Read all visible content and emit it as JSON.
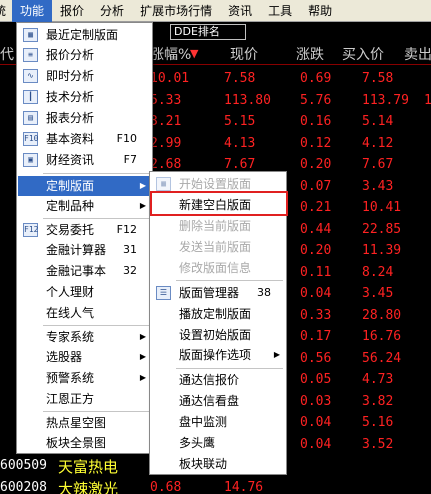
{
  "menubar": {
    "items": [
      "统",
      "功能",
      "报价",
      "分析",
      "扩展市场行情",
      "资讯",
      "工具",
      "帮助"
    ],
    "active_index": 1
  },
  "grid": {
    "dde_label": "DDE排名",
    "headers": {
      "code_prefix": "代",
      "change_pct": "涨幅%",
      "sort_arrow": "▼",
      "price": "现价",
      "change": "涨跌",
      "bid": "买入价",
      "ask": "卖出"
    },
    "rows": [
      {
        "pct": "10.01",
        "price": "7.58",
        "chg": "0.69",
        "bid": "7.58"
      },
      {
        "pct": "5.33",
        "price": "113.80",
        "chg": "5.76",
        "bid": "113.79",
        "ask": "1"
      },
      {
        "pct": "3.21",
        "price": "5.15",
        "chg": "0.16",
        "bid": "5.14"
      },
      {
        "pct": "2.99",
        "price": "4.13",
        "chg": "0.12",
        "bid": "4.12"
      },
      {
        "pct": "2.68",
        "price": "7.67",
        "chg": "0.20",
        "bid": "7.67"
      },
      {
        "chg": "0.07",
        "bid": "3.43"
      },
      {
        "chg": "0.21",
        "bid": "10.41"
      },
      {
        "chg": "0.44",
        "bid": "22.85"
      },
      {
        "chg": "0.20",
        "bid": "11.39"
      },
      {
        "chg": "0.11",
        "bid": "8.24"
      },
      {
        "chg": "0.04",
        "bid": "3.45"
      },
      {
        "chg": "0.33",
        "bid": "28.80"
      },
      {
        "chg": "0.17",
        "bid": "16.76"
      },
      {
        "chg": "0.56",
        "bid": "56.24"
      },
      {
        "chg": "0.05",
        "bid": "4.73"
      },
      {
        "chg": "0.03",
        "bid": "3.82"
      },
      {
        "chg": "0.04",
        "bid": "5.16"
      },
      {
        "chg": "0.04",
        "bid": "3.52"
      },
      {
        "code": "600509",
        "name": "天富热电"
      },
      {
        "code": "600208",
        "name": "大辣激光",
        "pct": "0.68",
        "price": "14.76"
      }
    ]
  },
  "menu_function": {
    "items": [
      {
        "label": "最近定制版面",
        "icon": "recent-layout-icon"
      },
      {
        "label": "报价分析",
        "icon": "quote-analysis-icon"
      },
      {
        "label": "即时分析",
        "icon": "realtime-analysis-icon"
      },
      {
        "label": "技术分析",
        "icon": "technical-analysis-icon"
      },
      {
        "label": "报表分析",
        "icon": "report-analysis-icon"
      },
      {
        "label": "基本资料",
        "accel": "F10",
        "icon": "f10-icon"
      },
      {
        "label": "财经资讯",
        "accel": "F7",
        "icon": "news-icon"
      },
      {
        "label": "定制版面",
        "submenu": true,
        "highlighted": true
      },
      {
        "label": "定制品种",
        "submenu": true
      },
      {
        "label": "交易委托",
        "accel": "F12",
        "icon": "f12-icon"
      },
      {
        "label": "金融计算器",
        "accel": "31"
      },
      {
        "label": "金融记事本",
        "accel": "32"
      },
      {
        "label": "个人理财"
      },
      {
        "label": "在线人气"
      },
      {
        "label": "专家系统",
        "submenu": true
      },
      {
        "label": "选股器",
        "submenu": true
      },
      {
        "label": "预警系统",
        "submenu": true
      },
      {
        "label": "江恩正方"
      },
      {
        "label": "热点星空图"
      },
      {
        "label": "板块全景图"
      }
    ]
  },
  "menu_custom_layout": {
    "items": [
      {
        "label": "开始设置版面",
        "disabled": true,
        "icon": "layout-setup-icon"
      },
      {
        "label": "新建空白版面",
        "boxed": true
      },
      {
        "label": "删除当前版面",
        "disabled": true
      },
      {
        "label": "发送当前版面",
        "disabled": true
      },
      {
        "label": "修改版面信息",
        "disabled": true
      },
      {
        "label": "版面管理器",
        "accel": "38",
        "icon": "layout-manager-icon"
      },
      {
        "label": "播放定制版面"
      },
      {
        "label": "设置初始版面"
      },
      {
        "label": "版面操作选项",
        "submenu": true
      },
      {
        "label": "通达信报价"
      },
      {
        "label": "通达信看盘"
      },
      {
        "label": "盘中监测"
      },
      {
        "label": "多头鹰"
      },
      {
        "label": "板块联动"
      }
    ]
  },
  "colors": {
    "menu_highlight": "#316ac5",
    "price_up": "#ff2222",
    "annotation_box": "#e02020"
  }
}
